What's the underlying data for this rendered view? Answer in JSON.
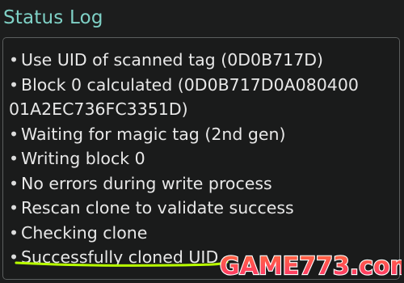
{
  "status_log": {
    "title": "Status Log",
    "bullet": "•",
    "lines": [
      "Use UID of scanned tag (0D0B717D)",
      "Block 0 calculated (0D0B717D0A080400",
      "01A2EC736FC3351D)",
      "Waiting for magic tag (2nd gen)",
      "Writing block 0",
      "No errors during write process",
      "Rescan clone to validate success",
      "Checking clone",
      "Successfully cloned UID"
    ]
  },
  "watermark": {
    "text": "GAME773.com"
  },
  "colors": {
    "background": "#1c1d1d",
    "title": "#7fd1c6",
    "text": "#e8e8e8",
    "border": "#5b5e5e",
    "highlight_underline": "#b8ff00"
  }
}
